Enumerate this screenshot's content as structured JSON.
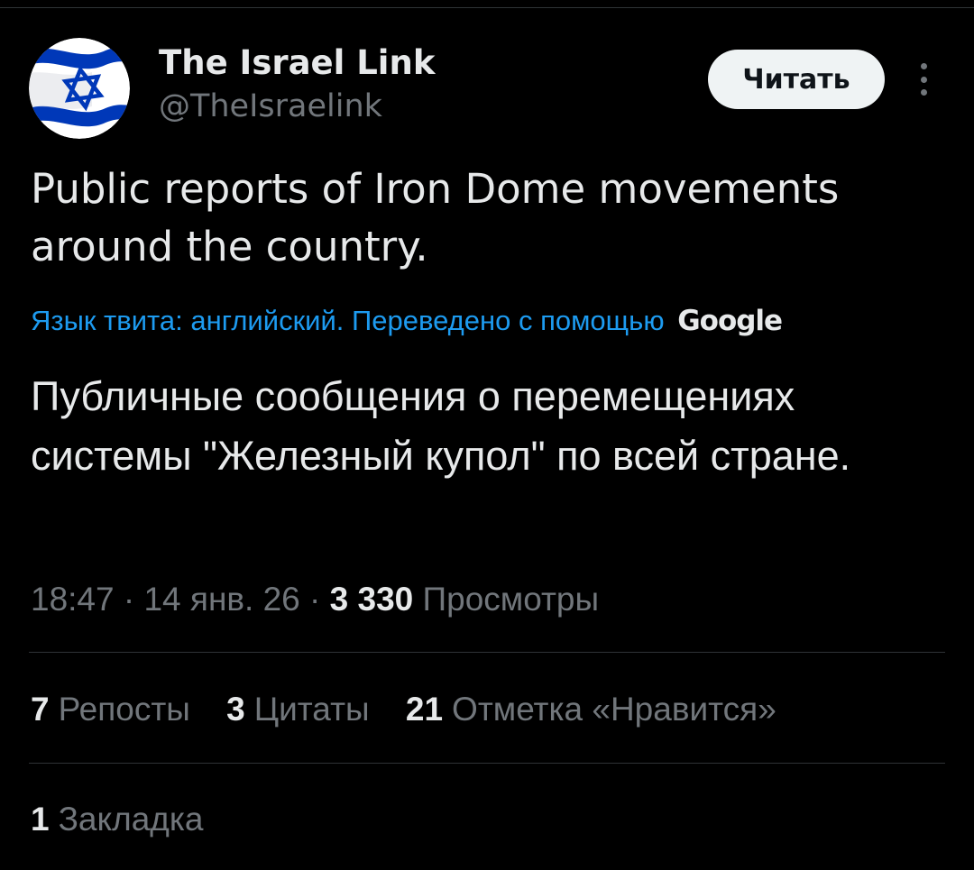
{
  "author": {
    "name": "The Israel Link",
    "handle": "@TheIsraelink",
    "avatar_icon": "israel-flag-icon"
  },
  "header": {
    "follow_label": "Читать",
    "more_icon": "more-vertical-icon"
  },
  "tweet": {
    "text": "Public reports of Iron Dome movements around the country.",
    "translation_note": "Язык твита: английский. Переведено с помощью",
    "translation_provider": "Google",
    "translated_text": "Публичные сообщения о перемещениях системы \"Железный купол\" по всей стране."
  },
  "meta": {
    "time": "18:47",
    "separator": " · ",
    "date": "14 янв. 26",
    "views_count": "3 330",
    "views_label": "Просмотры"
  },
  "stats": {
    "reposts_count": "7",
    "reposts_label": "Репосты",
    "quotes_count": "3",
    "quotes_label": "Цитаты",
    "likes_count": "21",
    "likes_label": "Отметка «Нравится»",
    "bookmarks_count": "1",
    "bookmarks_label": "Закладка"
  },
  "colors": {
    "background": "#000000",
    "text_primary": "#e7e9ea",
    "text_secondary": "#71767b",
    "link": "#1d9bf0",
    "flag_blue": "#0038b8"
  }
}
